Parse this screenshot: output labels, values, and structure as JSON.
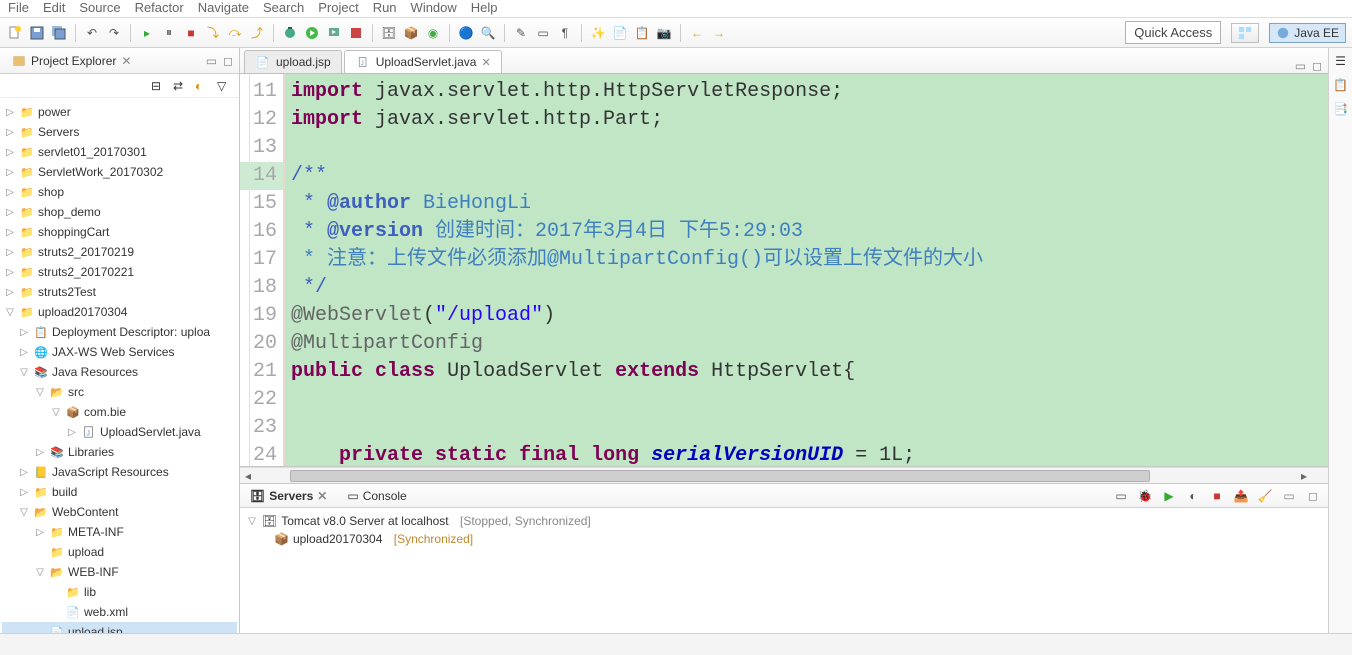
{
  "menubar": [
    "File",
    "Edit",
    "Source",
    "Refactor",
    "Navigate",
    "Search",
    "Project",
    "Run",
    "Window",
    "Help"
  ],
  "quickAccess": "Quick Access",
  "perspective": {
    "javaee": "Java EE"
  },
  "projectExplorer": {
    "title": "Project Explorer",
    "projects": [
      {
        "name": "power"
      },
      {
        "name": "Servers"
      },
      {
        "name": "servlet01_20170301"
      },
      {
        "name": "ServletWork_20170302"
      },
      {
        "name": "shop"
      },
      {
        "name": "shop_demo"
      },
      {
        "name": "shoppingCart"
      },
      {
        "name": "struts2_20170219"
      },
      {
        "name": "struts2_20170221"
      },
      {
        "name": "struts2Test"
      }
    ],
    "openProject": {
      "name": "upload20170304",
      "deployment": "Deployment Descriptor: uploa",
      "jaxws": "JAX-WS Web Services",
      "javaRes": "Java Resources",
      "src": "src",
      "pkg": "com.bie",
      "jfile": "UploadServlet.java",
      "libs": "Libraries",
      "jsRes": "JavaScript Resources",
      "build": "build",
      "webContent": "WebContent",
      "metaInf": "META-INF",
      "upload": "upload",
      "webInf": "WEB-INF",
      "lib": "lib",
      "webxml": "web.xml",
      "uploadjsp": "upload.jsp"
    }
  },
  "editorTabs": {
    "tab1": "upload.jsp",
    "tab2": "UploadServlet.java"
  },
  "code": {
    "lines": [
      "11",
      "12",
      "13",
      "14",
      "15",
      "16",
      "17",
      "18",
      "19",
      "20",
      "21",
      "22",
      "23",
      "24"
    ],
    "l11_kw": "import",
    "l11_rest": " javax.servlet.http.HttpServletResponse;",
    "l12_kw": "import",
    "l12_rest": " javax.servlet.http.Part;",
    "l14": "/**",
    "l15_pre": " * ",
    "l15_tag": "@author",
    "l15_rest": " BieHongLi",
    "l16_pre": " * ",
    "l16_tag": "@version",
    "l16_rest": " 创建时间：2017年3月4日 下午5:29:03",
    "l17": " * 注意：上传文件必须添加@MultipartConfig()可以设置上传文件的大小",
    "l18": " */",
    "l19_ann": "@WebServlet",
    "l19_p": "(",
    "l19_str": "\"/upload\"",
    "l19_p2": ")",
    "l20": "@MultipartConfig",
    "l21_kw1": "public",
    "l21_kw2": "class",
    "l21_cn": "UploadServlet",
    "l21_kw3": "extends",
    "l21_sn": "HttpServlet{",
    "l24_kw1": "private",
    "l24_kw2": "static",
    "l24_kw3": "final",
    "l24_kw4": "long",
    "l24_fld": "serialVersionUID",
    "l24_rest": " = 1L;"
  },
  "bottomPanel": {
    "serversTab": "Servers",
    "consoleTab": "Console",
    "server": {
      "name": "Tomcat v8.0 Server at localhost",
      "status": "[Stopped, Synchronized]"
    },
    "module": {
      "name": "upload20170304",
      "status": "[Synchronized]"
    }
  }
}
